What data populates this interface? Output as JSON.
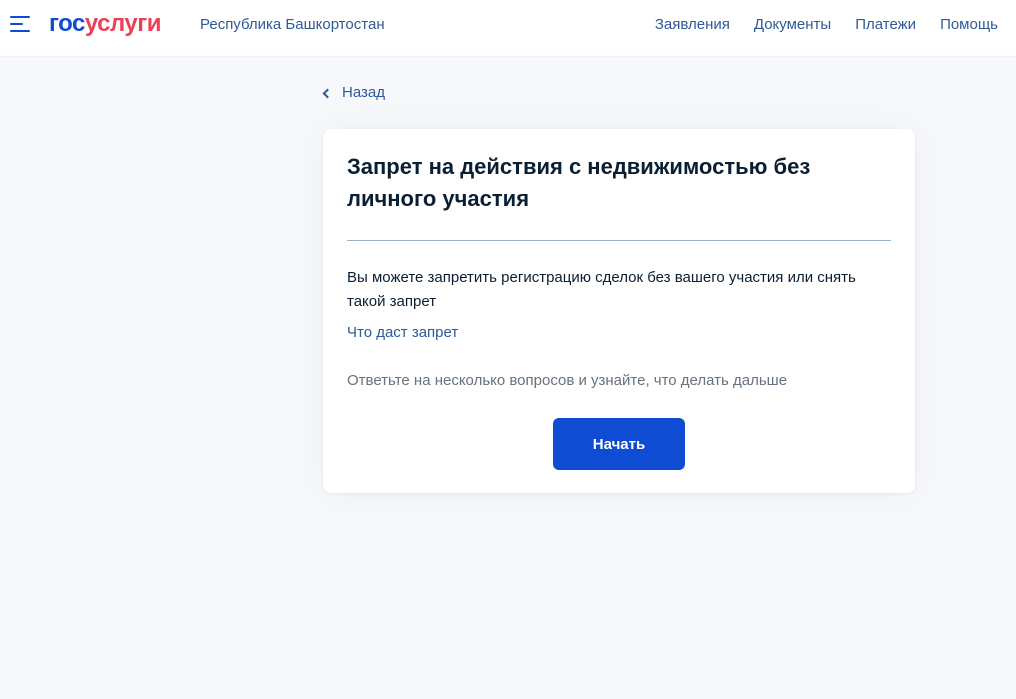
{
  "header": {
    "logo": {
      "part1": "гос",
      "part2": "услуги"
    },
    "region": "Республика Башкортостан",
    "nav": [
      {
        "label": "Заявления"
      },
      {
        "label": "Документы"
      },
      {
        "label": "Платежи"
      },
      {
        "label": "Помощь"
      }
    ]
  },
  "back": {
    "label": "Назад",
    "icon": "chevron-left-icon"
  },
  "card": {
    "title": "Запрет на действия с недвижимостью без личного участия",
    "description": "Вы можете запретить регистрацию сделок без вашего участия или снять такой запрет",
    "link": "Что даст запрет",
    "hint": "Ответьте на несколько вопросов и узнайте, что делать дальше",
    "start_button": "Начать"
  },
  "colors": {
    "accent": "#0d4cd3",
    "brand_red": "#ee3f58",
    "link": "#2e5a96",
    "background": "#f6f8fc"
  }
}
